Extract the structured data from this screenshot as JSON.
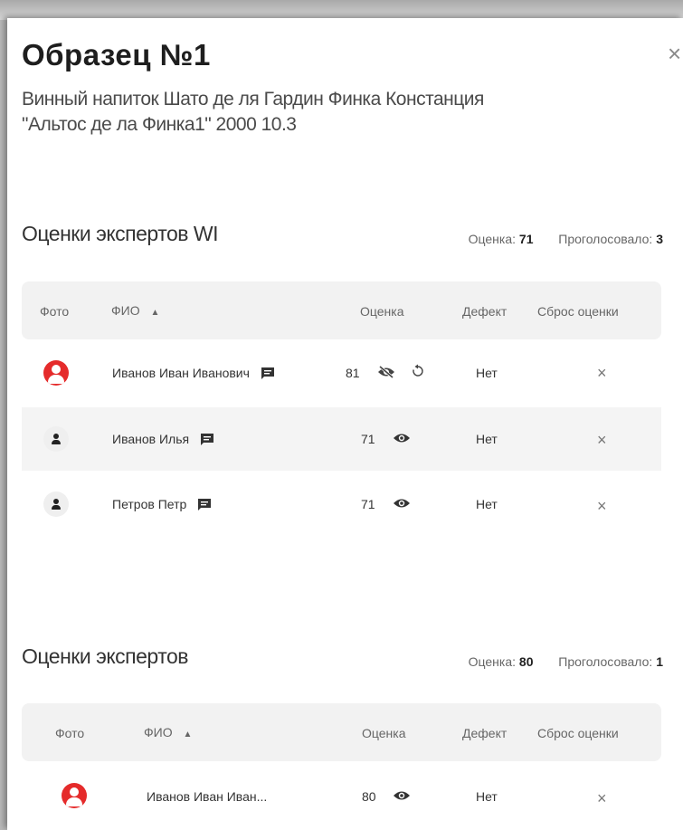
{
  "sample": {
    "title": "Образец №1",
    "subtitle": "Винный напиток Шато де ля Гардин Финка Констанция \"Альтос де ла Финка1\" 2000 10.3"
  },
  "sections": [
    {
      "title": "Оценки экспертов WI",
      "score_label": "Оценка:",
      "score": "71",
      "voted_label": "Проголосовало:",
      "voted": "3",
      "headers": {
        "photo": "Фото",
        "name": "ФИО",
        "score": "Оценка",
        "defect": "Дефект",
        "reset": "Сброс оценки"
      },
      "rows": [
        {
          "avatar": "red-user-icon",
          "name": "Иванов Иван Иванович",
          "score": "81",
          "visibility": "eye-off-icon",
          "reset_icon": "refresh-icon",
          "defect": "Нет"
        },
        {
          "avatar": "gray-user-icon",
          "name": "Иванов Илья",
          "score": "71",
          "visibility": "eye-icon",
          "defect": "Нет"
        },
        {
          "avatar": "gray-user-icon",
          "name": "Петров Петр",
          "score": "71",
          "visibility": "eye-icon",
          "defect": "Нет"
        }
      ]
    },
    {
      "title": "Оценки экспертов",
      "score_label": "Оценка:",
      "score": "80",
      "voted_label": "Проголосовало:",
      "voted": "1",
      "headers": {
        "photo": "Фото",
        "name": "ФИО",
        "score": "Оценка",
        "defect": "Дефект",
        "reset": "Сброс оценки"
      },
      "rows": [
        {
          "avatar": "red-user-icon",
          "name": "Иванов Иван Иван...",
          "score": "80",
          "visibility": "eye-icon",
          "defect": "Нет"
        }
      ]
    }
  ],
  "close_symbol": "×",
  "reset_symbol": "×",
  "colors": {
    "accent_red": "#e52b2b",
    "header_bg": "#f2f2f2",
    "row_alt": "#f4f4f4"
  }
}
